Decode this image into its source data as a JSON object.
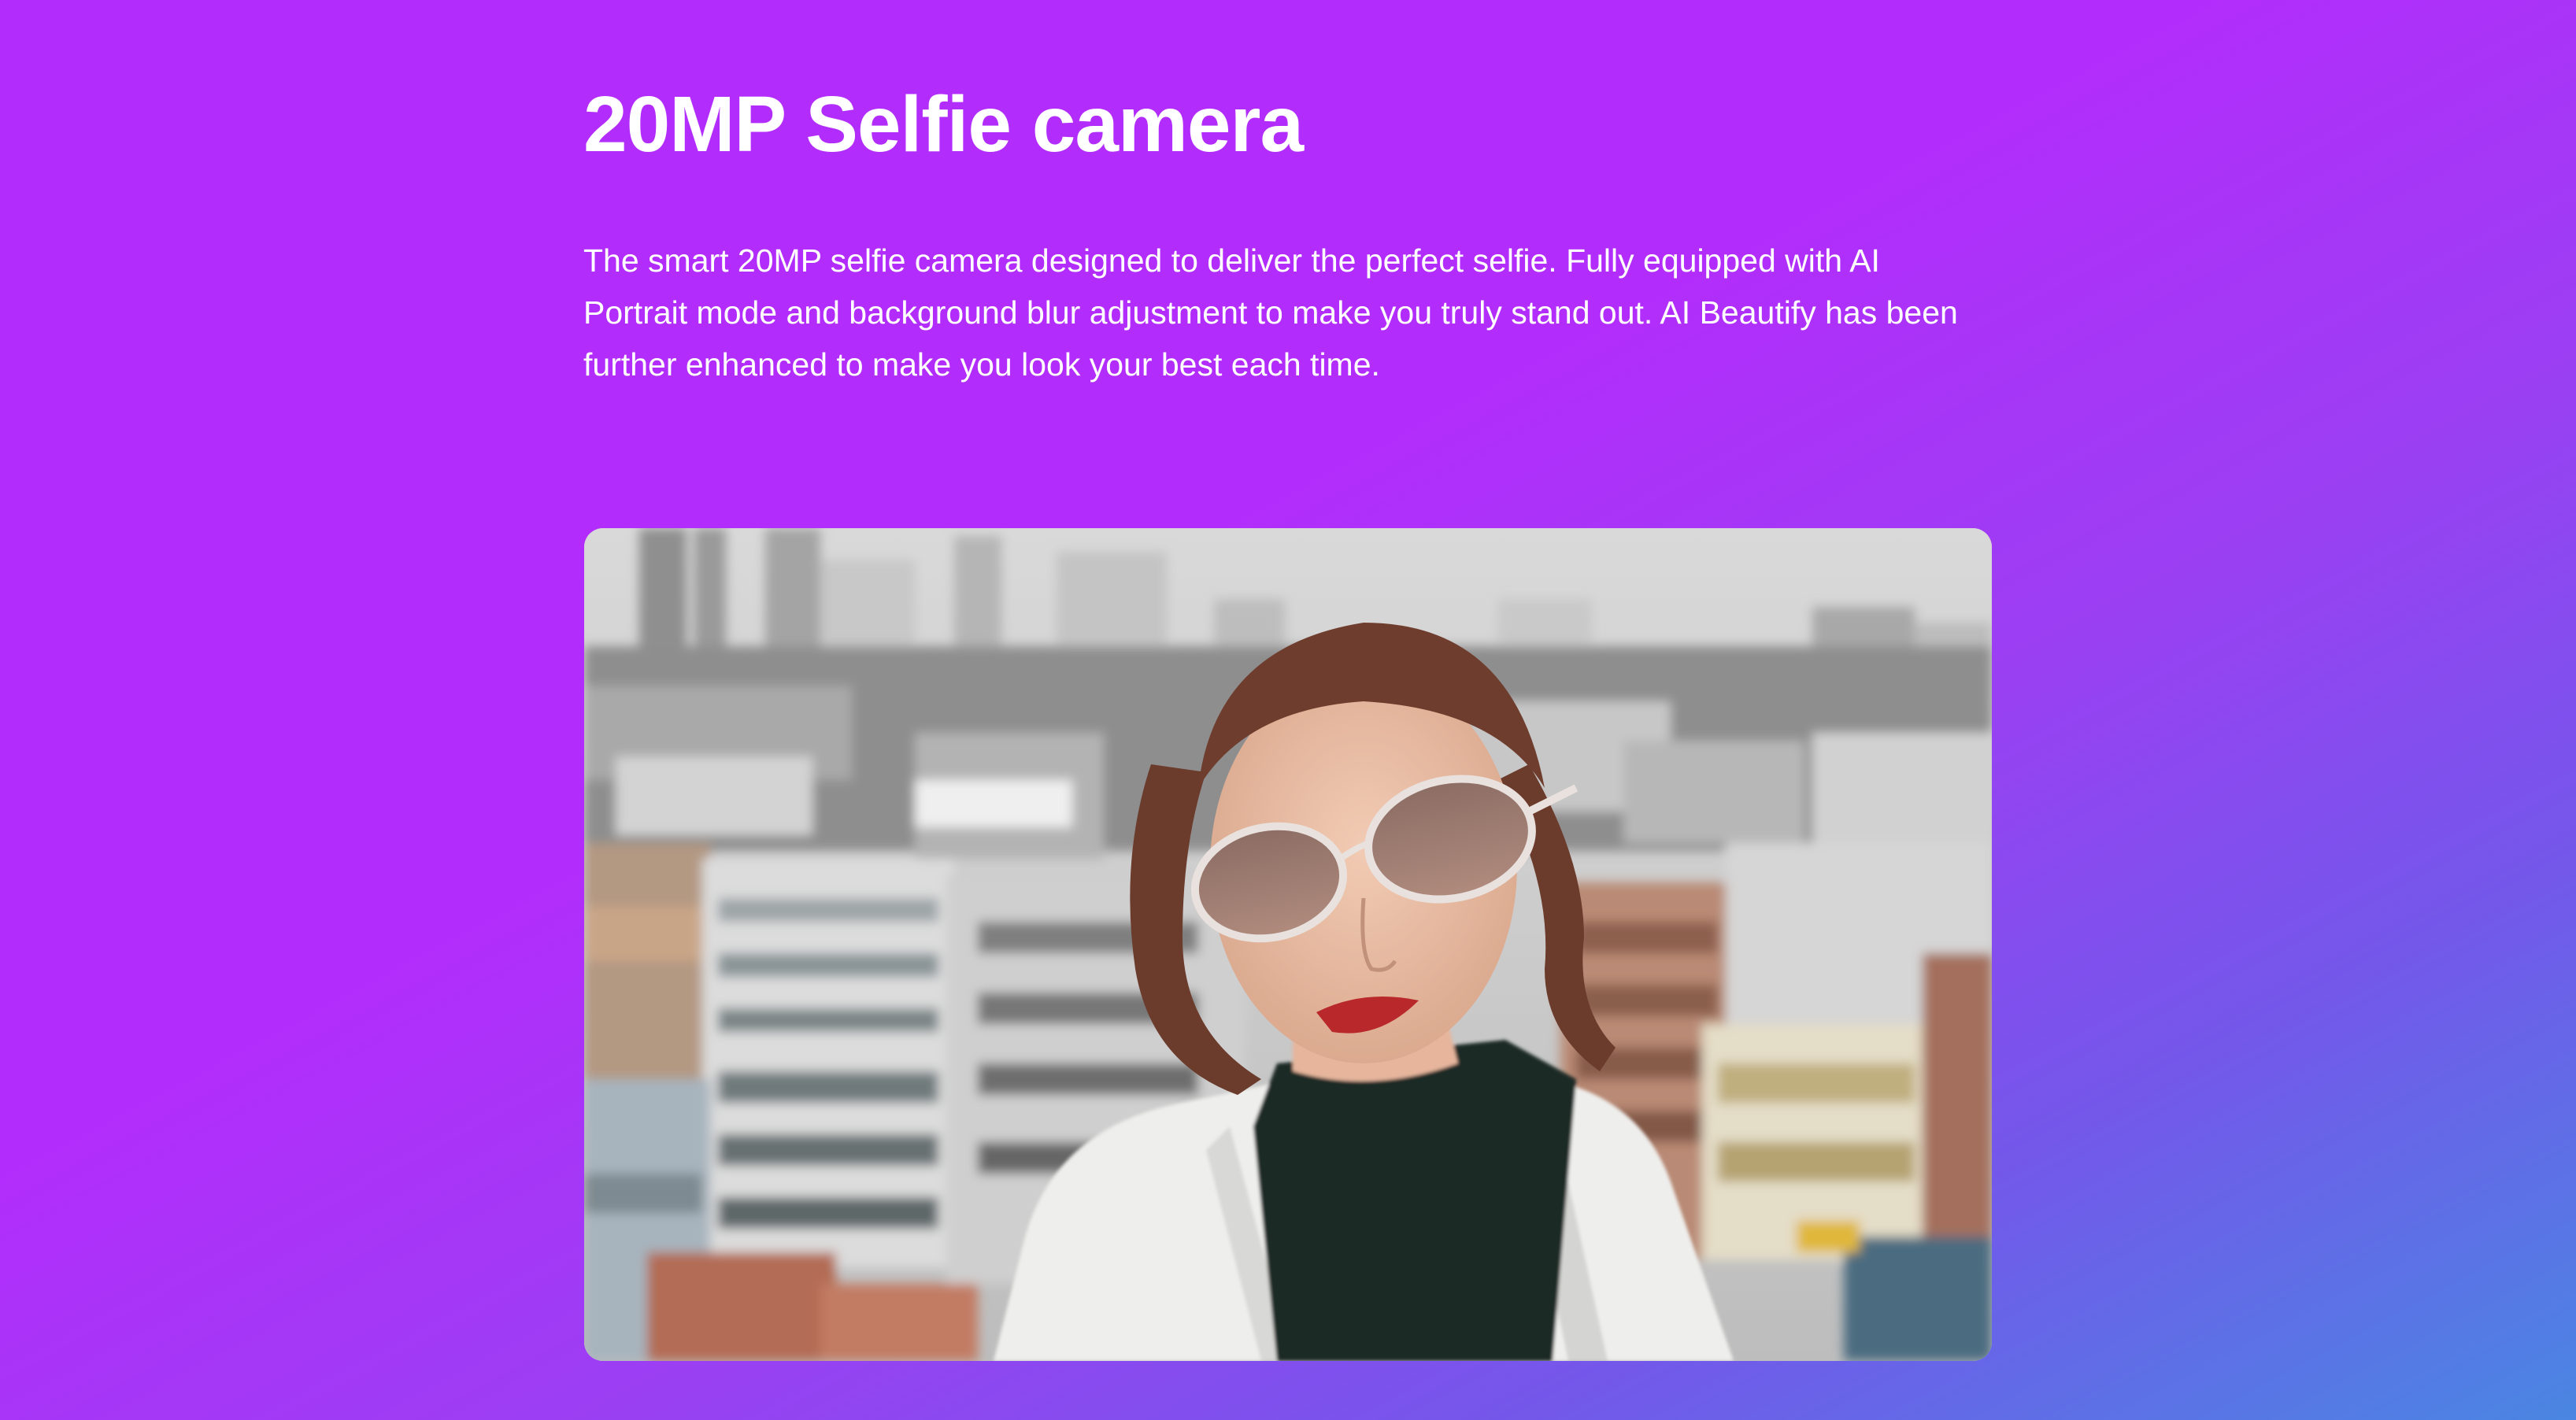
{
  "section": {
    "title": "20MP Selfie camera",
    "description": "The smart 20MP selfie camera designed to deliver the perfect selfie. Fully equipped with AI Portrait mode and background blur adjustment to make you truly stand out. AI Beautify has been further enhanced to make you look your best each time."
  },
  "colors": {
    "gradient_start": "#b22dfb",
    "gradient_end": "#4a86e2",
    "text": "#ffffff"
  }
}
